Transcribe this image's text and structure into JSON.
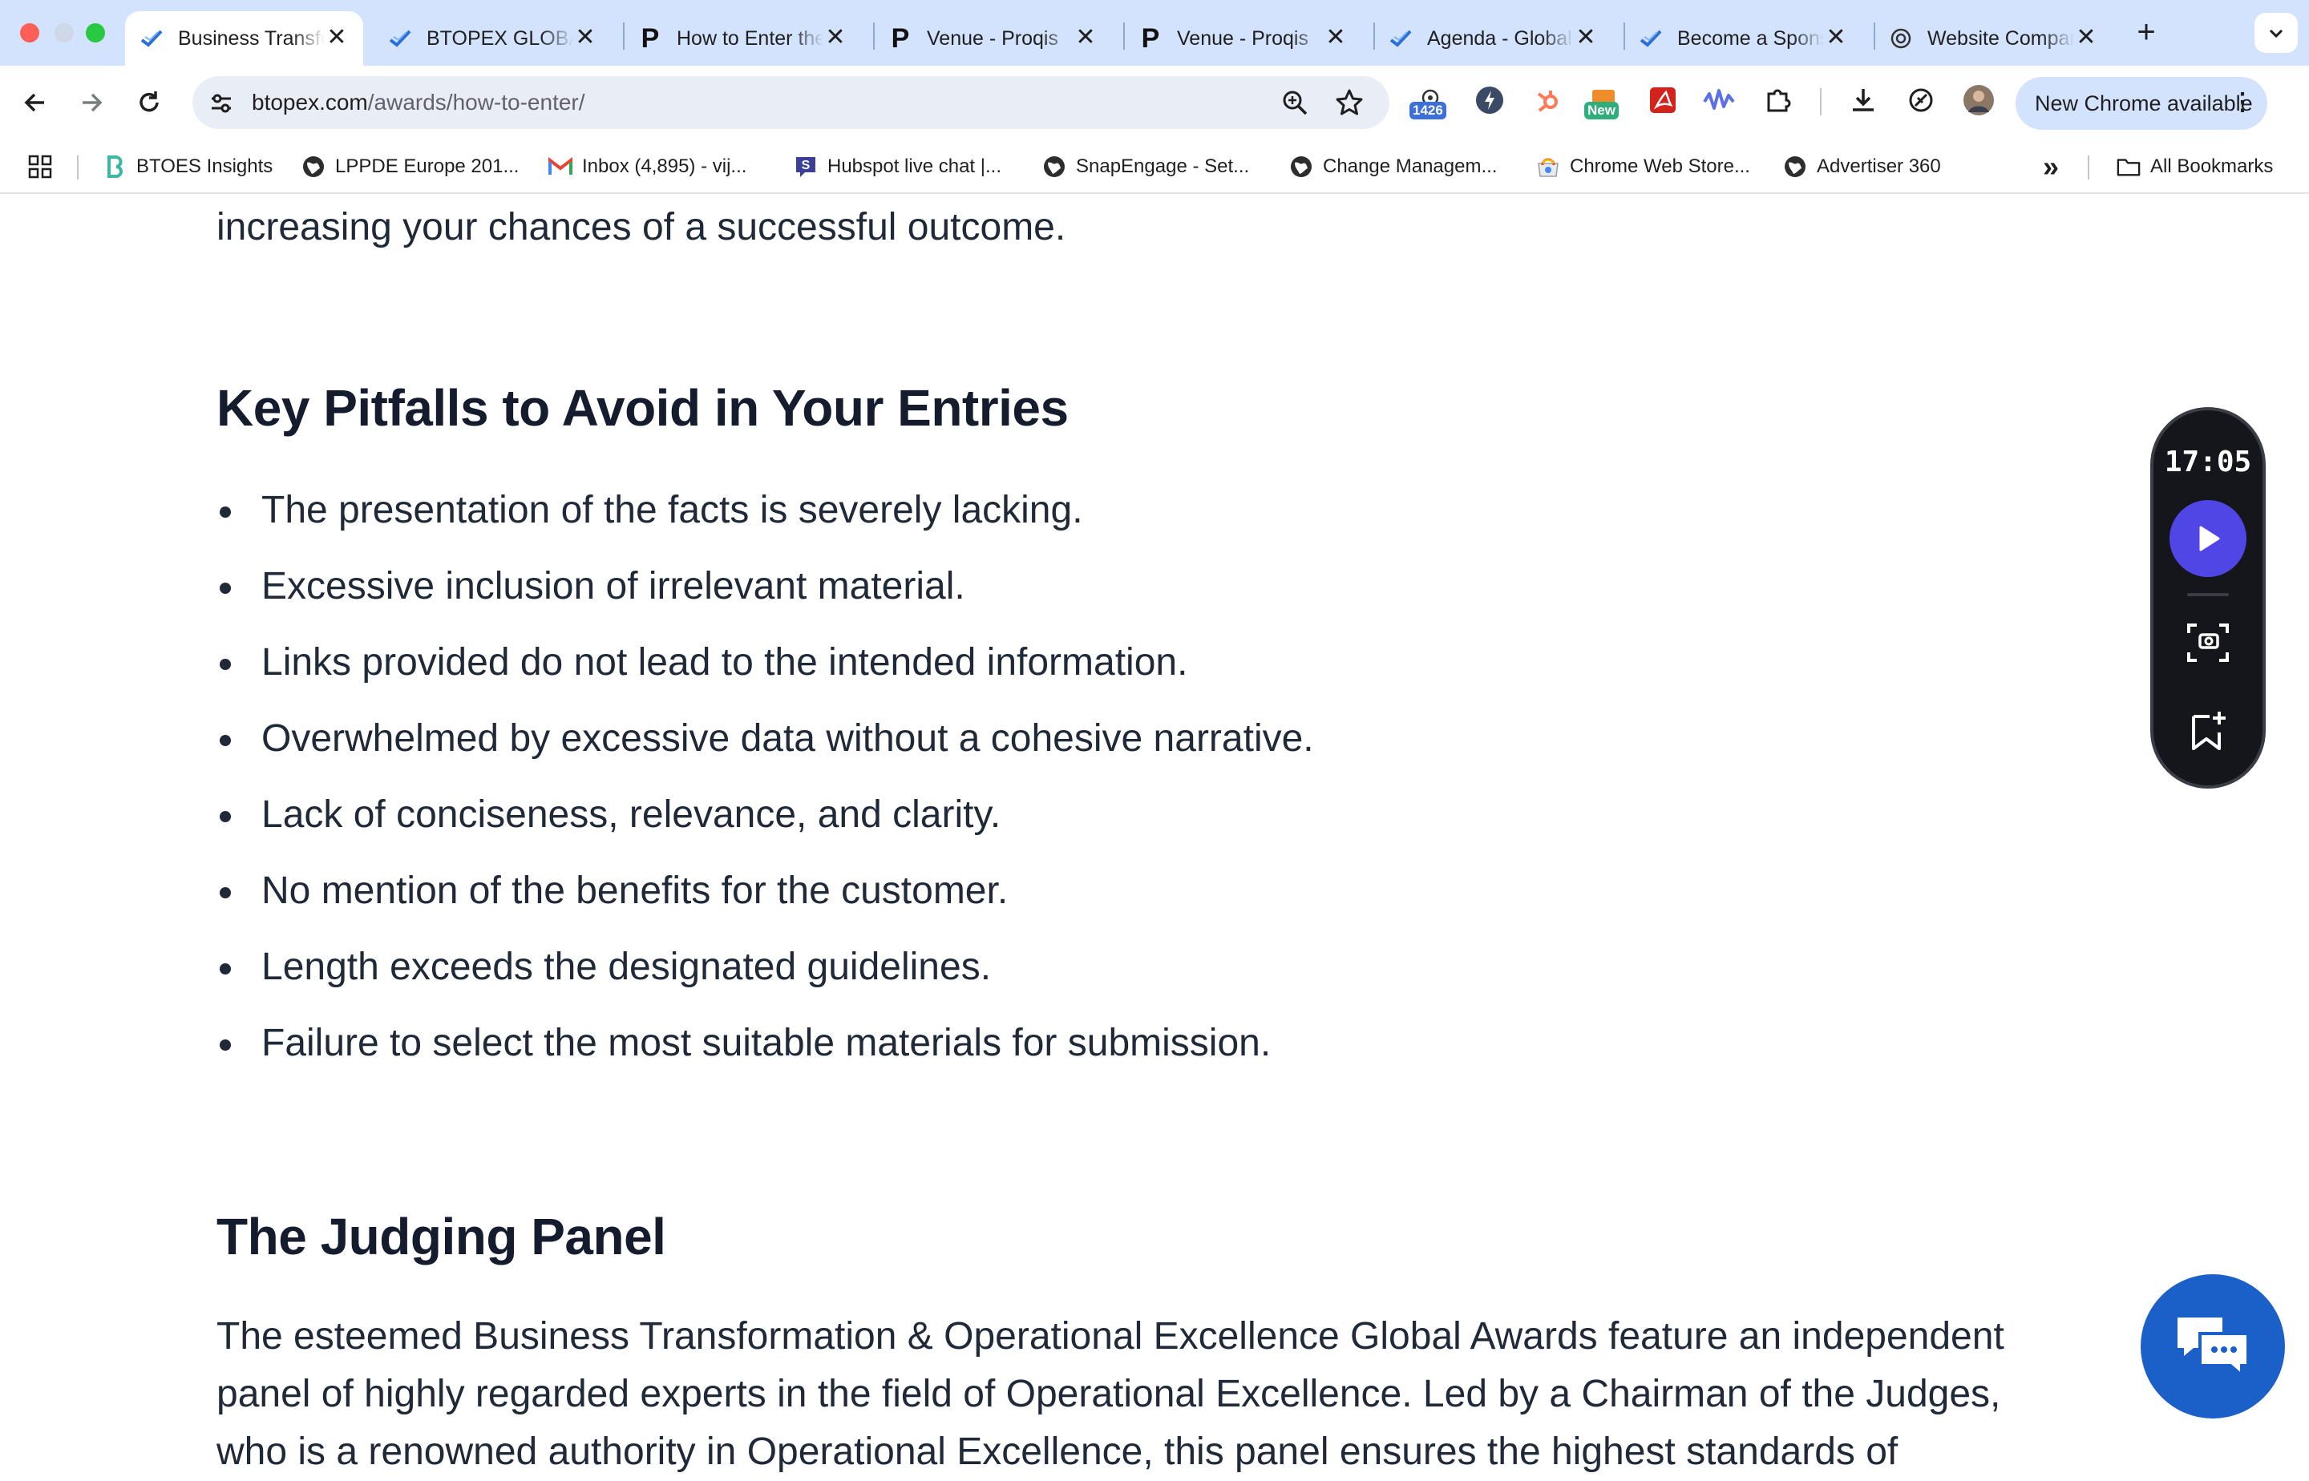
{
  "browser": {
    "tabs": [
      {
        "title": "Business Transformation & Operational Excellence",
        "favicon": "btoes-checkmark-icon",
        "active": true
      },
      {
        "title": "BTOPEX GLOBAL AWARDS",
        "favicon": "btoes-checkmark-icon",
        "active": false
      },
      {
        "title": "How to Enter the Awards",
        "favicon": "proqis-p-icon",
        "active": false
      },
      {
        "title": "Venue - Proqis",
        "favicon": "proqis-p-icon",
        "active": false
      },
      {
        "title": "Venue - Proqis",
        "favicon": "proqis-p-icon",
        "active": false
      },
      {
        "title": "Agenda - Global",
        "favicon": "btoes-checkmark-icon",
        "active": false
      },
      {
        "title": "Become a Sponsor",
        "favicon": "btoes-checkmark-icon",
        "active": false
      },
      {
        "title": "Website Compare",
        "favicon": "openai-icon",
        "active": false
      }
    ],
    "tab_close_glyph": "✕",
    "new_tab_glyph": "+",
    "address": {
      "domain": "btopex.com",
      "path": "/awards/how-to-enter/"
    },
    "extension_badges": {
      "count": "1426",
      "new": "New"
    },
    "update_button": "New Chrome available",
    "bookmarks": [
      {
        "label": "BTOES Insights",
        "icon": "btoes-b-icon"
      },
      {
        "label": "LPPDE Europe 201...",
        "icon": "globe-icon"
      },
      {
        "label": "Inbox (4,895) - vij...",
        "icon": "gmail-icon"
      },
      {
        "label": "Hubspot live chat |...",
        "icon": "snapengage-icon"
      },
      {
        "label": "SnapEngage - Set...",
        "icon": "globe-icon"
      },
      {
        "label": "Change Managem...",
        "icon": "globe-icon"
      },
      {
        "label": "Chrome Web Store...",
        "icon": "webstore-icon"
      },
      {
        "label": "Advertiser 360",
        "icon": "globe-icon"
      }
    ],
    "bookmarks_overflow": "»",
    "all_bookmarks": "All Bookmarks"
  },
  "page": {
    "intro_tail": "increasing your chances of a successful outcome.",
    "pitfalls_heading": "Key Pitfalls to Avoid in Your Entries",
    "pitfalls": [
      "The presentation of the facts is severely lacking.",
      "Excessive inclusion of irrelevant material.",
      "Links provided do not lead to the intended information.",
      "Overwhelmed by excessive data without a cohesive narrative.",
      "Lack of conciseness, relevance, and clarity.",
      "No mention of the benefits for the customer.",
      "Length exceeds the designated guidelines.",
      "Failure to select the most suitable materials for submission."
    ],
    "judging_heading": "The Judging Panel",
    "judging_paragraph": "The esteemed Business Transformation & Operational Excellence Global Awards feature an independent panel of highly regarded experts in the field of Operational Excellence. Led by a Chairman of the Judges, who is a renowned authority in Operational Excellence, this panel ensures the highest standards of"
  },
  "recorder": {
    "time": "17:05"
  },
  "colors": {
    "tabstrip": "#d3e3fd",
    "accent": "#4f46e5",
    "chat": "#1b5fc9",
    "heading": "#141c2e"
  }
}
